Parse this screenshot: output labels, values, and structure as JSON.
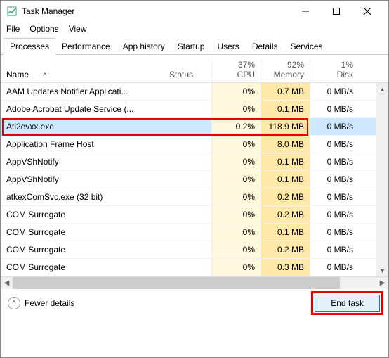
{
  "window": {
    "title": "Task Manager"
  },
  "menu": {
    "file": "File",
    "options": "Options",
    "view": "View"
  },
  "tabs": [
    "Processes",
    "Performance",
    "App history",
    "Startup",
    "Users",
    "Details",
    "Services"
  ],
  "active_tab": 0,
  "columns": {
    "name": "Name",
    "status": "Status",
    "cpu": {
      "pct": "37%",
      "label": "CPU"
    },
    "memory": {
      "pct": "92%",
      "label": "Memory"
    },
    "disk": {
      "pct": "1%",
      "label": "Disk"
    }
  },
  "rows": [
    {
      "name": "AAM Updates Notifier Applicati...",
      "cpu": "0%",
      "mem": "0.7 MB",
      "disk": "0 MB/s"
    },
    {
      "name": "Adobe Acrobat Update Service (...",
      "cpu": "0%",
      "mem": "0.1 MB",
      "disk": "0 MB/s"
    },
    {
      "name": "Ati2evxx.exe",
      "cpu": "0.2%",
      "mem": "118.9 MB",
      "disk": "0 MB/s",
      "selected": true,
      "highlight": true
    },
    {
      "name": "Application Frame Host",
      "cpu": "0%",
      "mem": "8.0 MB",
      "disk": "0 MB/s"
    },
    {
      "name": "AppVShNotify",
      "cpu": "0%",
      "mem": "0.1 MB",
      "disk": "0 MB/s"
    },
    {
      "name": "AppVShNotify",
      "cpu": "0%",
      "mem": "0.1 MB",
      "disk": "0 MB/s"
    },
    {
      "name": "atkexComSvc.exe (32 bit)",
      "cpu": "0%",
      "mem": "0.2 MB",
      "disk": "0 MB/s"
    },
    {
      "name": "COM Surrogate",
      "cpu": "0%",
      "mem": "0.2 MB",
      "disk": "0 MB/s"
    },
    {
      "name": "COM Surrogate",
      "cpu": "0%",
      "mem": "0.1 MB",
      "disk": "0 MB/s"
    },
    {
      "name": "COM Surrogate",
      "cpu": "0%",
      "mem": "0.2 MB",
      "disk": "0 MB/s"
    },
    {
      "name": "COM Surrogate",
      "cpu": "0%",
      "mem": "0.3 MB",
      "disk": "0 MB/s"
    }
  ],
  "footer": {
    "fewer": "Fewer details",
    "end_task": "End task"
  }
}
